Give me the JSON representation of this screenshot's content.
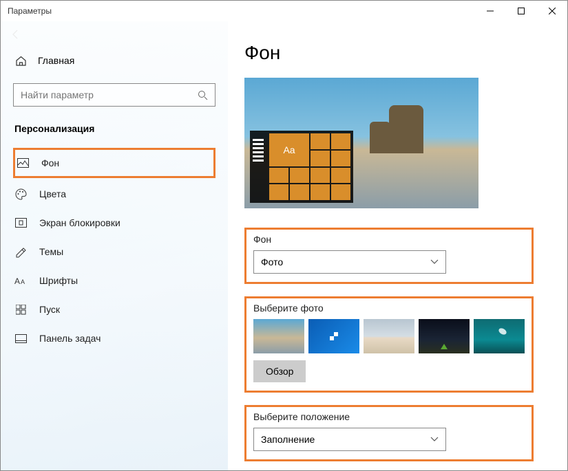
{
  "window": {
    "title": "Параметры"
  },
  "sidebar": {
    "home": "Главная",
    "search_placeholder": "Найти параметр",
    "section": "Персонализация",
    "items": [
      {
        "label": "Фон"
      },
      {
        "label": "Цвета"
      },
      {
        "label": "Экран блокировки"
      },
      {
        "label": "Темы"
      },
      {
        "label": "Шрифты"
      },
      {
        "label": "Пуск"
      },
      {
        "label": "Панель задач"
      }
    ]
  },
  "main": {
    "title": "Фон",
    "preview_tile_text": "Aa",
    "background_section_label": "Фон",
    "background_dropdown_value": "Фото",
    "choose_photo_label": "Выберите фото",
    "browse_label": "Обзор",
    "position_label": "Выберите положение",
    "position_value": "Заполнение"
  }
}
